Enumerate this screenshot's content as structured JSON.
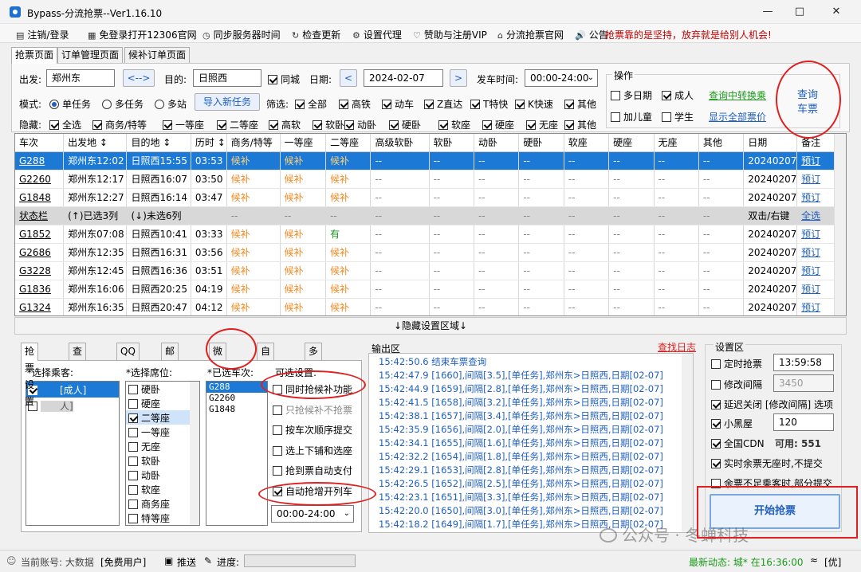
{
  "window": {
    "title": "Bypass-分流抢票--Ver1.16.10"
  },
  "menu": {
    "items": [
      "注销/登录",
      "免登录打开12306官网",
      "同步服务器时间",
      "检查更新",
      "设置代理",
      "赞助与注册VIP",
      "分流抢票官网"
    ],
    "notice_label": "公告:",
    "notice_text": "抢票靠的是坚持，放弃就是给别人机会!"
  },
  "tabs": [
    "抢票页面",
    "订单管理页面",
    "候补订单页面"
  ],
  "query": {
    "from_label": "出发:",
    "from_value": "郑州东",
    "swap_label": "<-->",
    "to_label": "目的:",
    "to_value": "日照西",
    "same_city_label": "同城",
    "date_label": "日期:",
    "date_value": "2024-02-07",
    "prev": "<",
    "next": ">",
    "time_label": "发车时间:",
    "time_value": "00:00-24:00",
    "mode_label": "模式:",
    "mode_options": [
      "单任务",
      "多任务",
      "多站"
    ],
    "new_task_button": "导入新任务",
    "filter_label": "筛选:",
    "filters": [
      "全部",
      "高铁",
      "动车",
      "Z直达",
      "T特快",
      "K快速",
      "其他"
    ],
    "hide_label": "隐藏:",
    "hide_options": [
      "全选",
      "商务/特等",
      "一等座",
      "二等座",
      "高软",
      "软卧",
      "动卧",
      "硬卧",
      "软座",
      "硬座",
      "无座",
      "其他"
    ]
  },
  "ops": {
    "legend": "操作",
    "multi_date": "多日期",
    "adult": "成人",
    "child": "加儿童",
    "student": "学生",
    "transfer_link": "查询中转换乘",
    "show_all_link": "显示全部票价",
    "query_button": "查询\n车票"
  },
  "grid": {
    "headers": [
      "车次",
      "出发地 ↕",
      "目的地 ↕",
      "历时 ↕",
      "商务/特等",
      "一等座",
      "二等座",
      "高级软卧",
      "软卧",
      "动卧",
      "硬卧",
      "软座",
      "硬座",
      "无座",
      "其他",
      "日期",
      "备注"
    ],
    "rows": [
      [
        "G288",
        "郑州东12:02",
        "日照西15:55",
        "03:53",
        "候补",
        "候补",
        "候补",
        "--",
        "--",
        "--",
        "--",
        "--",
        "--",
        "--",
        "--",
        "20240207",
        "预订"
      ],
      [
        "G2260",
        "郑州东12:17",
        "日照西16:07",
        "03:50",
        "候补",
        "候补",
        "候补",
        "--",
        "--",
        "--",
        "--",
        "--",
        "--",
        "--",
        "--",
        "20240207",
        "预订"
      ],
      [
        "G1848",
        "郑州东12:27",
        "日照西16:14",
        "03:47",
        "候补",
        "候补",
        "候补",
        "--",
        "--",
        "--",
        "--",
        "--",
        "--",
        "--",
        "--",
        "20240207",
        "预订"
      ],
      [
        "状态栏",
        "(↑)已选3列",
        "(↓)未选6列",
        "",
        "--",
        "--",
        "--",
        "--",
        "--",
        "--",
        "--",
        "--",
        "--",
        "--",
        "--",
        "双击/右键",
        "全选"
      ],
      [
        "G1852",
        "郑州东07:08",
        "日照西10:41",
        "03:33",
        "候补",
        "候补",
        "有",
        "--",
        "--",
        "--",
        "--",
        "--",
        "--",
        "--",
        "--",
        "20240207",
        "预订"
      ],
      [
        "G2686",
        "郑州东12:35",
        "日照西16:31",
        "03:56",
        "候补",
        "候补",
        "候补",
        "--",
        "--",
        "--",
        "--",
        "--",
        "--",
        "--",
        "--",
        "20240207",
        "预订"
      ],
      [
        "G3228",
        "郑州东12:45",
        "日照西16:36",
        "03:51",
        "候补",
        "候补",
        "候补",
        "--",
        "--",
        "--",
        "--",
        "--",
        "--",
        "--",
        "--",
        "20240207",
        "预订"
      ],
      [
        "G1836",
        "郑州东16:06",
        "日照西20:25",
        "04:19",
        "候补",
        "候补",
        "候补",
        "--",
        "--",
        "--",
        "--",
        "--",
        "--",
        "--",
        "--",
        "20240207",
        "预订"
      ],
      [
        "G1324",
        "郑州东16:35",
        "日照西20:47",
        "04:12",
        "候补",
        "候补",
        "候补",
        "--",
        "--",
        "--",
        "--",
        "--",
        "--",
        "--",
        "--",
        "20240207",
        "预订"
      ]
    ]
  },
  "hidden_area": "↓隐藏设置区域↓",
  "bottom_tabs": [
    "抢票设置",
    "查询起售",
    "QQ通知",
    "邮件通知",
    "微信通知",
    "自动支付",
    "多任务设置"
  ],
  "passengers": {
    "label": "*选择乘客:",
    "items": [
      "　　[成人]",
      "　　人]"
    ]
  },
  "seats": {
    "label": "*选择席位:",
    "items": [
      "硬卧",
      "硬座",
      "二等座",
      "一等座",
      "无座",
      "软卧",
      "动卧",
      "软座",
      "商务座",
      "特等座"
    ]
  },
  "trains": {
    "label": "*已选车次:",
    "items": [
      "G288",
      "G2260",
      "G1848"
    ]
  },
  "optional": {
    "label": "可选设置:",
    "items": [
      "同时抢候补功能",
      "只抢候补不抢票",
      "按车次顺序提交",
      "选上下铺和选座",
      "抢到票自动支付",
      "自动抢增开列车"
    ],
    "time_value": "00:00-24:00"
  },
  "output": {
    "label": "输出区",
    "find_log": "查找日志",
    "lines": [
      "15:42:50.6  结束车票查询",
      "15:42:47.9 [1660],间隔[3.5],[单任务],郑州东>日照西,日期[02-07]",
      "15:42:44.9 [1659],间隔[2.8],[单任务],郑州东>日照西,日期[02-07]",
      "15:42:41.5 [1658],间隔[3.2],[单任务],郑州东>日照西,日期[02-07]",
      "15:42:38.1 [1657],间隔[3.4],[单任务],郑州东>日照西,日期[02-07]",
      "15:42:35.9 [1656],间隔[2.0],[单任务],郑州东>日照西,日期[02-07]",
      "15:42:34.1 [1655],间隔[1.6],[单任务],郑州东>日照西,日期[02-07]",
      "15:42:32.2 [1654],间隔[1.8],[单任务],郑州东>日照西,日期[02-07]",
      "15:42:29.1 [1653],间隔[2.8],[单任务],郑州东>日照西,日期[02-07]",
      "15:42:26.5 [1652],间隔[2.5],[单任务],郑州东>日照西,日期[02-07]",
      "15:42:23.1 [1651],间隔[3.3],[单任务],郑州东>日照西,日期[02-07]",
      "15:42:20.0 [1650],间隔[3.0],[单任务],郑州东>日照西,日期[02-07]",
      "15:42:18.2 [1649],间隔[1.7],[单任务],郑州东>日照西,日期[02-07]"
    ]
  },
  "settings": {
    "label": "设置区",
    "timed_label": "定时抢票",
    "timed_value": "13:59:58",
    "interval_label": "修改间隔",
    "interval_value": "3450",
    "delay_label": "延迟关闭 [修改间隔] 选项",
    "blackroom_label": "小黑屋",
    "blackroom_value": "120",
    "cdn_label": "全国CDN",
    "cdn_avail": "可用: 551",
    "realtime_label": "实时余票无座时,不提交",
    "partial_label": "余票不足乘客时,部分提交",
    "start_button": "开始抢票"
  },
  "statusbar": {
    "user": "当前账号: 大数据",
    "user_type": "[免费用户]",
    "push": "推送",
    "progress": "进度:",
    "latest": "最新动态: 城* 在16:36:00",
    "tag": "[优]"
  },
  "watermark": "公众号 · 冬蝉科技",
  "colors": {
    "accent": "#1f5fbf",
    "selected_row": "#1c7ad6",
    "candidate": "#f08a24",
    "available": "#1a9a1a",
    "annotation": "#e02020",
    "notice": "#c00000"
  }
}
